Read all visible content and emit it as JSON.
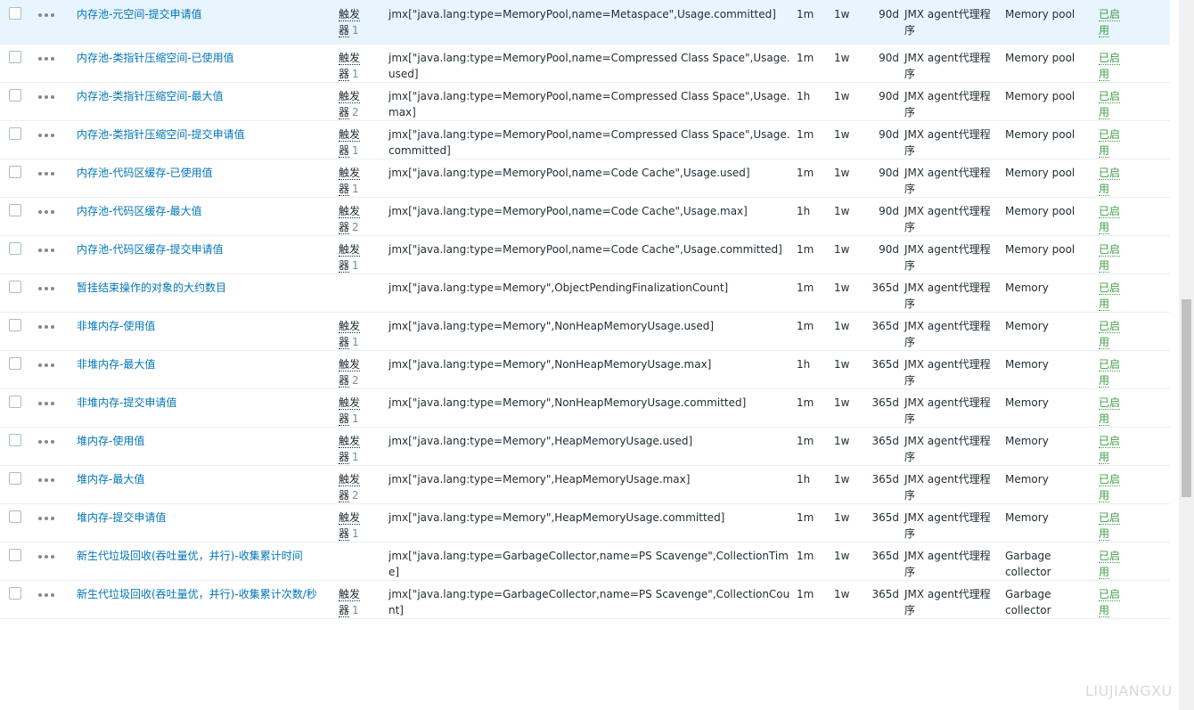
{
  "rows": [
    {
      "name": "内存池-元空间-提交申请值",
      "trigger_label": "触发器",
      "trigger_count": "1",
      "key": "jmx[\"java.lang:type=MemoryPool,name=Metaspace\",Usage.committed]",
      "interval": "1m",
      "history": "1w",
      "trends": "90d",
      "type": "JMX agent代理程序",
      "application": "Memory pool",
      "status": "已启用",
      "highlight": true
    },
    {
      "name": "内存池-类指针压缩空间-已使用值",
      "trigger_label": "触发器",
      "trigger_count": "1",
      "key": "jmx[\"java.lang:type=MemoryPool,name=Compressed Class Space\",Usage.used]",
      "interval": "1m",
      "history": "1w",
      "trends": "90d",
      "type": "JMX agent代理程序",
      "application": "Memory pool",
      "status": "已启用"
    },
    {
      "name": "内存池-类指针压缩空间-最大值",
      "trigger_label": "触发器",
      "trigger_count": "2",
      "key": "jmx[\"java.lang:type=MemoryPool,name=Compressed Class Space\",Usage.max]",
      "interval": "1h",
      "history": "1w",
      "trends": "90d",
      "type": "JMX agent代理程序",
      "application": "Memory pool",
      "status": "已启用"
    },
    {
      "name": "内存池-类指针压缩空间-提交申请值",
      "trigger_label": "触发器",
      "trigger_count": "1",
      "key": "jmx[\"java.lang:type=MemoryPool,name=Compressed Class Space\",Usage.committed]",
      "interval": "1m",
      "history": "1w",
      "trends": "90d",
      "type": "JMX agent代理程序",
      "application": "Memory pool",
      "status": "已启用"
    },
    {
      "name": "内存池-代码区缓存-已使用值",
      "trigger_label": "触发器",
      "trigger_count": "1",
      "key": "jmx[\"java.lang:type=MemoryPool,name=Code Cache\",Usage.used]",
      "interval": "1m",
      "history": "1w",
      "trends": "90d",
      "type": "JMX agent代理程序",
      "application": "Memory pool",
      "status": "已启用"
    },
    {
      "name": "内存池-代码区缓存-最大值",
      "trigger_label": "触发器",
      "trigger_count": "2",
      "key": "jmx[\"java.lang:type=MemoryPool,name=Code Cache\",Usage.max]",
      "interval": "1h",
      "history": "1w",
      "trends": "90d",
      "type": "JMX agent代理程序",
      "application": "Memory pool",
      "status": "已启用"
    },
    {
      "name": "内存池-代码区缓存-提交申请值",
      "trigger_label": "触发器",
      "trigger_count": "1",
      "key": "jmx[\"java.lang:type=MemoryPool,name=Code Cache\",Usage.committed]",
      "interval": "1m",
      "history": "1w",
      "trends": "90d",
      "type": "JMX agent代理程序",
      "application": "Memory pool",
      "status": "已启用"
    },
    {
      "name": "暂挂结束操作的对象的大约数目",
      "trigger_label": "",
      "trigger_count": "",
      "key": "jmx[\"java.lang:type=Memory\",ObjectPendingFinalizationCount]",
      "interval": "1m",
      "history": "1w",
      "trends": "365d",
      "type": "JMX agent代理程序",
      "application": "Memory",
      "status": "已启用"
    },
    {
      "name": "非堆内存-使用值",
      "trigger_label": "触发器",
      "trigger_count": "1",
      "key": "jmx[\"java.lang:type=Memory\",NonHeapMemoryUsage.used]",
      "interval": "1m",
      "history": "1w",
      "trends": "365d",
      "type": "JMX agent代理程序",
      "application": "Memory",
      "status": "已启用"
    },
    {
      "name": "非堆内存-最大值",
      "trigger_label": "触发器",
      "trigger_count": "2",
      "key": "jmx[\"java.lang:type=Memory\",NonHeapMemoryUsage.max]",
      "interval": "1h",
      "history": "1w",
      "trends": "365d",
      "type": "JMX agent代理程序",
      "application": "Memory",
      "status": "已启用"
    },
    {
      "name": "非堆内存-提交申请值",
      "trigger_label": "触发器",
      "trigger_count": "1",
      "key": "jmx[\"java.lang:type=Memory\",NonHeapMemoryUsage.committed]",
      "interval": "1m",
      "history": "1w",
      "trends": "365d",
      "type": "JMX agent代理程序",
      "application": "Memory",
      "status": "已启用"
    },
    {
      "name": "堆内存-使用值",
      "trigger_label": "触发器",
      "trigger_count": "1",
      "key": "jmx[\"java.lang:type=Memory\",HeapMemoryUsage.used]",
      "interval": "1m",
      "history": "1w",
      "trends": "365d",
      "type": "JMX agent代理程序",
      "application": "Memory",
      "status": "已启用"
    },
    {
      "name": "堆内存-最大值",
      "trigger_label": "触发器",
      "trigger_count": "2",
      "key": "jmx[\"java.lang:type=Memory\",HeapMemoryUsage.max]",
      "interval": "1h",
      "history": "1w",
      "trends": "365d",
      "type": "JMX agent代理程序",
      "application": "Memory",
      "status": "已启用"
    },
    {
      "name": "堆内存-提交申请值",
      "trigger_label": "触发器",
      "trigger_count": "1",
      "key": "jmx[\"java.lang:type=Memory\",HeapMemoryUsage.committed]",
      "interval": "1m",
      "history": "1w",
      "trends": "365d",
      "type": "JMX agent代理程序",
      "application": "Memory",
      "status": "已启用"
    },
    {
      "name": "新生代垃圾回收(吞吐量优，并行)-收集累计时间",
      "trigger_label": "",
      "trigger_count": "",
      "key": "jmx[\"java.lang:type=GarbageCollector,name=PS Scavenge\",CollectionTime]",
      "interval": "1m",
      "history": "1w",
      "trends": "365d",
      "type": "JMX agent代理程序",
      "application": "Garbage collector",
      "status": "已启用"
    },
    {
      "name": "新生代垃圾回收(吞吐量优，并行)-收集累计次数/秒",
      "trigger_label": "触发器",
      "trigger_count": "1",
      "key": "jmx[\"java.lang:type=GarbageCollector,name=PS Scavenge\",CollectionCount]",
      "interval": "1m",
      "history": "1w",
      "trends": "365d",
      "type": "JMX agent代理程序",
      "application": "Garbage collector",
      "status": "已启用"
    }
  ],
  "watermark": "LIUJIANGXU"
}
